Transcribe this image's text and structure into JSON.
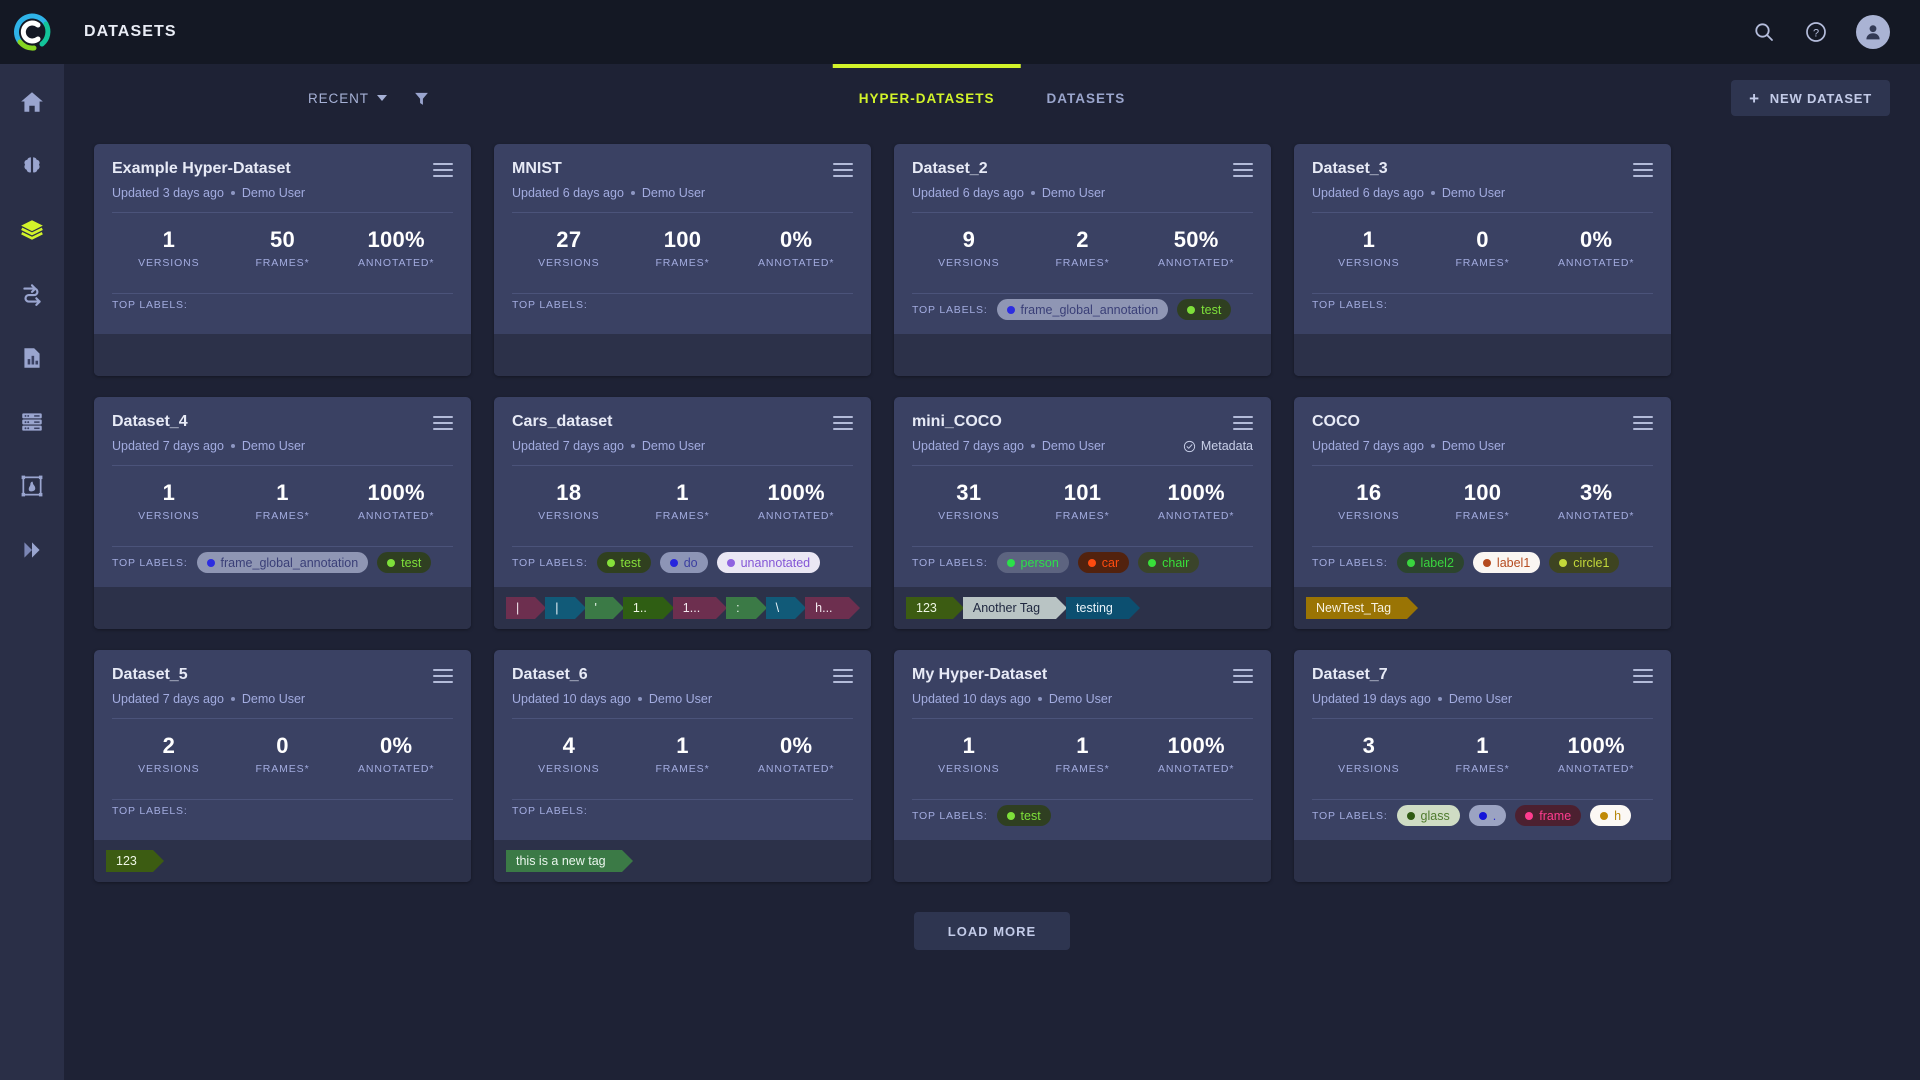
{
  "header": {
    "title": "DATASETS",
    "icons": [
      "search-icon",
      "help-icon",
      "account-icon"
    ]
  },
  "sidebar": {
    "items": [
      {
        "name": "home",
        "active": false
      },
      {
        "name": "brain",
        "active": false
      },
      {
        "name": "layers",
        "active": true
      },
      {
        "name": "pipelines",
        "active": false
      },
      {
        "name": "reports",
        "active": false
      },
      {
        "name": "datastores",
        "active": false
      },
      {
        "name": "annotations",
        "active": false
      },
      {
        "name": "expand",
        "active": false
      }
    ],
    "accent": "#d2f32a"
  },
  "toolbar": {
    "sort_label": "RECENT",
    "filter_icon": "filter-icon",
    "new_dataset_label": "NEW DATASET",
    "tabs": [
      {
        "label": "HYPER-DATASETS",
        "active": true
      },
      {
        "label": "DATASETS",
        "active": false
      }
    ]
  },
  "footer": {
    "load_more_label": "LOAD MORE"
  },
  "labels_caption": "TOP LABELS:",
  "stat_labels": [
    "VERSIONS",
    "FRAMES*",
    "ANNOTATED*"
  ],
  "cards": [
    {
      "title": "Example Hyper-Dataset",
      "updated": "Updated 3 days ago",
      "user": "Demo User",
      "metadata": null,
      "stats": [
        "1",
        "50",
        "100%"
      ],
      "labels": [],
      "tags": []
    },
    {
      "title": "MNIST",
      "updated": "Updated 6 days ago",
      "user": "Demo User",
      "metadata": null,
      "stats": [
        "27",
        "100",
        "0%"
      ],
      "labels": [],
      "tags": []
    },
    {
      "title": "Dataset_2",
      "updated": "Updated 6 days ago",
      "user": "Demo User",
      "metadata": null,
      "stats": [
        "9",
        "2",
        "50%"
      ],
      "labels": [
        {
          "text": "frame_global_annotation",
          "bg": "#8f96b4",
          "fg": "#3a3f77",
          "bullet": "#2c2ce0"
        },
        {
          "text": "test",
          "bg": "#2f3f21",
          "fg": "#7ee03a",
          "bullet": "#7ee03a"
        }
      ],
      "tags": []
    },
    {
      "title": "Dataset_3",
      "updated": "Updated 6 days ago",
      "user": "Demo User",
      "metadata": null,
      "stats": [
        "1",
        "0",
        "0%"
      ],
      "labels": [],
      "tags": []
    },
    {
      "title": "Dataset_4",
      "updated": "Updated 7 days ago",
      "user": "Demo User",
      "metadata": null,
      "stats": [
        "1",
        "1",
        "100%"
      ],
      "labels": [
        {
          "text": "frame_global_annotation",
          "bg": "#8f96b4",
          "fg": "#3a3f77",
          "bullet": "#2c2ce0"
        },
        {
          "text": "test",
          "bg": "#2f3f21",
          "fg": "#7ee03a",
          "bullet": "#7ee03a"
        }
      ],
      "tags": []
    },
    {
      "title": "Cars_dataset",
      "updated": "Updated 7 days ago",
      "user": "Demo User",
      "metadata": null,
      "stats": [
        "18",
        "1",
        "100%"
      ],
      "labels": [
        {
          "text": "test",
          "bg": "#30401f",
          "fg": "#86e03a",
          "bullet": "#86e03a"
        },
        {
          "text": "do",
          "bg": "#8d95b6",
          "fg": "#3b3fa0",
          "bullet": "#2626dd"
        },
        {
          "text": "unannotated",
          "bg": "#eae7f4",
          "fg": "#8457d6",
          "bullet": "#8f63e0"
        }
      ],
      "tags": [
        {
          "text": "|",
          "bg": "#6d2f4f",
          "fg": "#f2e8ee"
        },
        {
          "text": "|",
          "bg": "#115a78",
          "fg": "#e8f3f8"
        },
        {
          "text": "'",
          "bg": "#3b7a46",
          "fg": "#e9f6ec"
        },
        {
          "text": "1..",
          "bg": "#2f5e13",
          "fg": "#eef6e4"
        },
        {
          "text": "1...",
          "bg": "#6d2f4f",
          "fg": "#f3e9ef"
        },
        {
          "text": ":",
          "bg": "#3b7a46",
          "fg": "#eaf6ed"
        },
        {
          "text": "\\",
          "bg": "#115a78",
          "fg": "#e9f3f9"
        },
        {
          "text": "h...",
          "bg": "#6d2f4f",
          "fg": "#f3e9ef"
        }
      ]
    },
    {
      "title": "mini_COCO",
      "updated": "Updated 7 days ago",
      "user": "Demo User",
      "metadata": "Metadata",
      "stats": [
        "31",
        "101",
        "100%"
      ],
      "labels": [
        {
          "text": "person",
          "bg": "#5d6480",
          "fg": "#2ce04a",
          "bullet": "#2ce04a"
        },
        {
          "text": "car",
          "bg": "#52220e",
          "fg": "#ff4b10",
          "bullet": "#ff4b10"
        },
        {
          "text": "chair",
          "bg": "#3a442a",
          "fg": "#38e03a",
          "bullet": "#38e03a"
        }
      ],
      "tags": [
        {
          "text": "123",
          "bg": "#3c5c12",
          "fg": "#eef6e4"
        },
        {
          "text": "Another Tag",
          "bg": "#b9c4c4",
          "fg": "#202840"
        },
        {
          "text": "testing",
          "bg": "#0c4f70",
          "fg": "#e9f3f9"
        }
      ]
    },
    {
      "title": "COCO",
      "updated": "Updated 7 days ago",
      "user": "Demo User",
      "metadata": null,
      "stats": [
        "16",
        "100",
        "3%"
      ],
      "labels": [
        {
          "text": "label2",
          "bg": "#2c442e",
          "fg": "#3ad63f",
          "bullet": "#3ad63f"
        },
        {
          "text": "label1",
          "bg": "#faf6f2",
          "fg": "#b54b1f",
          "bullet": "#b54b1f"
        },
        {
          "text": "circle1",
          "bg": "#3e4421",
          "fg": "#c3d83a",
          "bullet": "#c3d83a"
        }
      ],
      "tags": [
        {
          "text": "NewTest_Tag",
          "bg": "#9a7404",
          "fg": "#f7f2e2"
        }
      ]
    },
    {
      "title": "Dataset_5",
      "updated": "Updated 7 days ago",
      "user": "Demo User",
      "metadata": null,
      "stats": [
        "2",
        "0",
        "0%"
      ],
      "labels": [],
      "tags": [
        {
          "text": "123",
          "bg": "#3c5c12",
          "fg": "#eef6e4"
        }
      ]
    },
    {
      "title": "Dataset_6",
      "updated": "Updated 10 days ago",
      "user": "Demo User",
      "metadata": null,
      "stats": [
        "4",
        "1",
        "0%"
      ],
      "labels": [],
      "tags": [
        {
          "text": "this is a new tag",
          "bg": "#3b7a46",
          "fg": "#eaf6ed"
        }
      ]
    },
    {
      "title": "My Hyper-Dataset",
      "updated": "Updated 10 days ago",
      "user": "Demo User",
      "metadata": null,
      "stats": [
        "1",
        "1",
        "100%"
      ],
      "labels": [
        {
          "text": "test",
          "bg": "#2f3f21",
          "fg": "#7ee03a",
          "bullet": "#7ee03a"
        }
      ],
      "tags": []
    },
    {
      "title": "Dataset_7",
      "updated": "Updated 19 days ago",
      "user": "Demo User",
      "metadata": null,
      "stats": [
        "3",
        "1",
        "100%"
      ],
      "labels": [
        {
          "text": "glass",
          "bg": "#cfdcc4",
          "fg": "#4f7a2e",
          "bullet": "#2f5a12"
        },
        {
          "text": ".",
          "bg": "#9ba3c2",
          "fg": "#2a2ad0",
          "bullet": "#1414d8"
        },
        {
          "text": "frame",
          "bg": "#4c2030",
          "fg": "#ff3c8f",
          "bullet": "#ff3c8f"
        },
        {
          "text": "h",
          "bg": "#fbf8f4",
          "fg": "#b5870c",
          "bullet": "#c08a06"
        }
      ],
      "tags": []
    }
  ]
}
